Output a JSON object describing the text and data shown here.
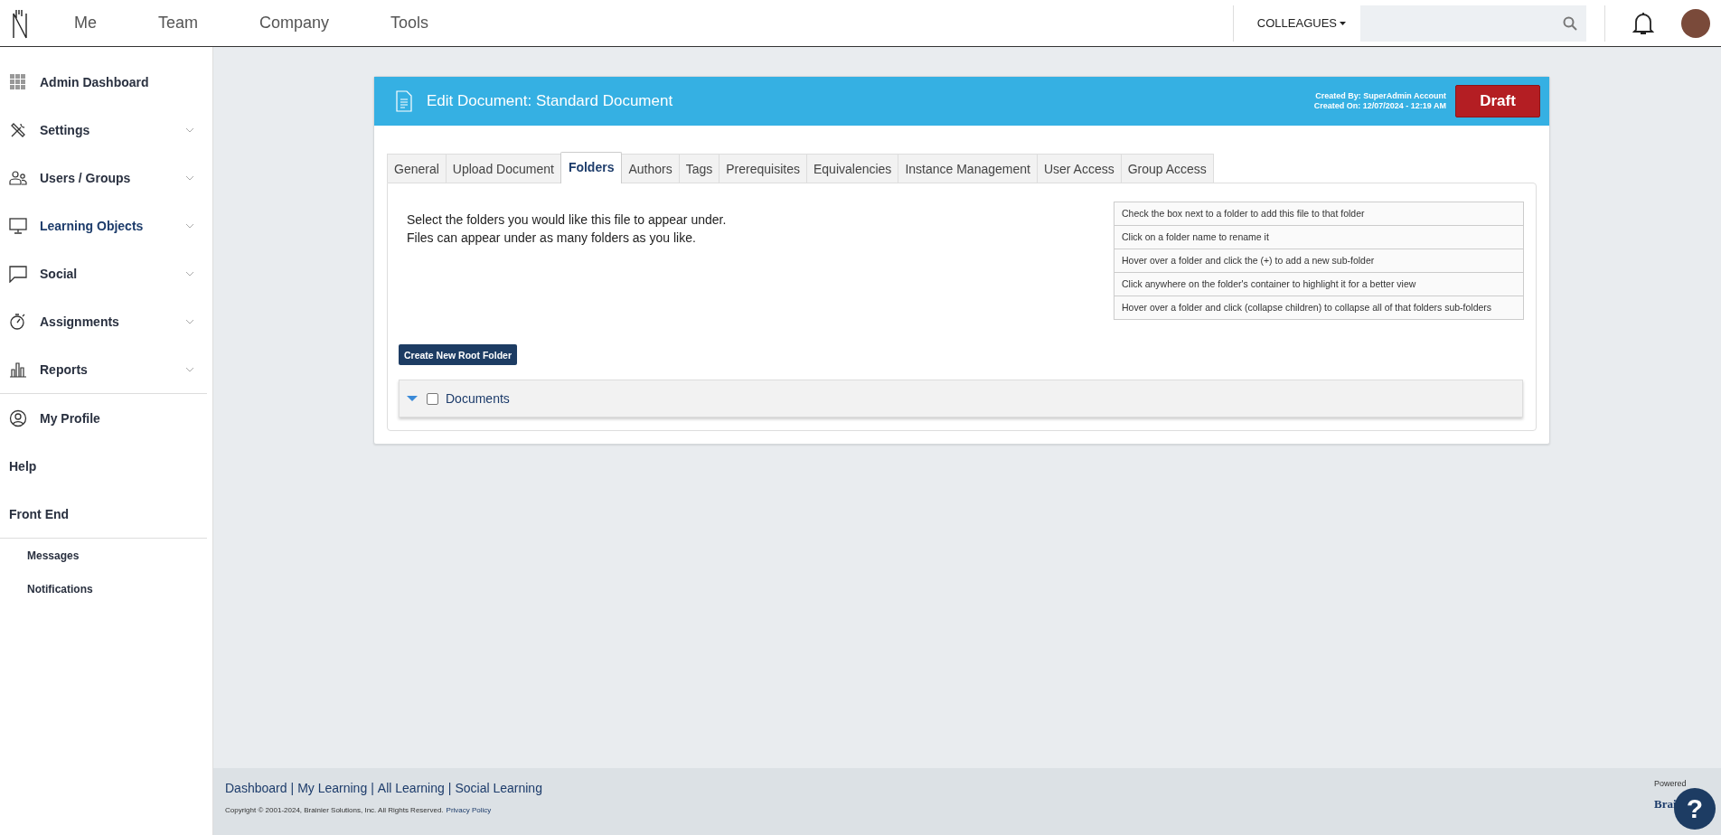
{
  "top_nav": {
    "items": [
      {
        "label": "Me",
        "selected": false
      },
      {
        "label": "Team",
        "selected": false
      },
      {
        "label": "Company",
        "selected": false
      },
      {
        "label": "Tools",
        "selected": false
      }
    ],
    "colleagues_dropdown": "COLLEAGUES"
  },
  "sidebar": {
    "items": [
      {
        "label": "Admin Dashboard",
        "kind": "main",
        "expandable": false,
        "selected": false
      },
      {
        "label": "Settings",
        "kind": "main",
        "expandable": true,
        "selected": false
      },
      {
        "label": "Users / Groups",
        "kind": "main",
        "expandable": true,
        "selected": false
      },
      {
        "label": "Learning Objects",
        "kind": "main",
        "expandable": true,
        "selected": true
      },
      {
        "label": "Social",
        "kind": "main",
        "expandable": true,
        "selected": false
      },
      {
        "label": "Assignments",
        "kind": "main",
        "expandable": true,
        "selected": false
      },
      {
        "label": "Reports",
        "kind": "main",
        "expandable": true,
        "selected": false
      },
      {
        "label": "My Profile",
        "kind": "profile",
        "expandable": false,
        "selected": false
      },
      {
        "label": "Help",
        "kind": "plain",
        "expandable": false,
        "selected": false
      },
      {
        "label": "Front End",
        "kind": "plain",
        "expandable": false,
        "selected": false
      },
      {
        "label": "Messages",
        "kind": "sub",
        "expandable": false,
        "selected": false
      },
      {
        "label": "Notifications",
        "kind": "sub",
        "expandable": false,
        "selected": false
      }
    ]
  },
  "card": {
    "title": "Edit Document: Standard Document",
    "created_by": "Created By: SuperAdmin Account",
    "created_on": "Created On: 12/07/2024 - 12:19 AM",
    "status": "Draft",
    "tabs": [
      {
        "label": "General",
        "selected": false
      },
      {
        "label": "Upload Document",
        "selected": false
      },
      {
        "label": "Folders",
        "selected": true
      },
      {
        "label": "Authors",
        "selected": false
      },
      {
        "label": "Tags",
        "selected": false
      },
      {
        "label": "Prerequisites",
        "selected": false
      },
      {
        "label": "Equivalencies",
        "selected": false
      },
      {
        "label": "Instance Management",
        "selected": false
      },
      {
        "label": "User Access",
        "selected": false
      },
      {
        "label": "Group Access",
        "selected": false
      }
    ],
    "instructions": [
      "Select the folders you would like this file to appear under.",
      "Files can appear under as many folders as you like."
    ],
    "help_rows": [
      "Check the box next to a folder to add this file to that folder",
      "Click on a folder name to rename it",
      "Hover over a folder and click the (+) to add a new sub-folder",
      "Click anywhere on the folder's container to highlight it for a better view",
      "Hover over a folder and click (collapse children) to collapse all of that folders sub-folders"
    ],
    "create_button": "Create New Root Folder",
    "folders": [
      {
        "name": "Documents",
        "expanded": true,
        "checked": false
      }
    ]
  },
  "footer": {
    "links": [
      "Dashboard",
      "My Learning",
      "All Learning",
      "Social Learning"
    ],
    "separator": "|",
    "copyright": "Copyright © 2001-2024, Brainier Solutions, Inc. All Rights Reserved.",
    "privacy_link": "Privacy Policy",
    "powered": "Powered",
    "brand": "Brai",
    "help_button": "?"
  }
}
